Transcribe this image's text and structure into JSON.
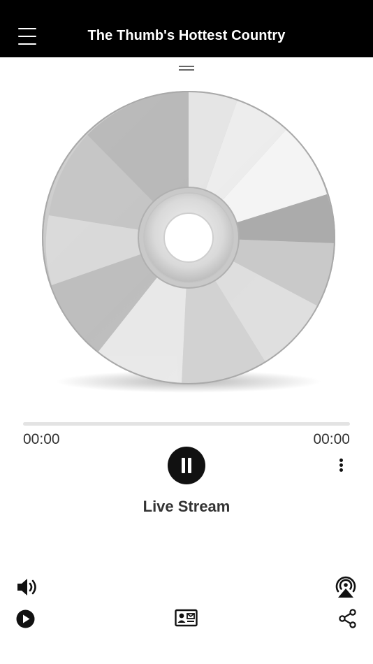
{
  "header": {
    "title": "The Thumb's Hottest Country"
  },
  "player": {
    "elapsed": "00:00",
    "duration": "00:00",
    "progress": 0,
    "track_title": "Live Stream",
    "state": "playing"
  },
  "icons": {
    "menu": "hamburger-menu-icon",
    "drag": "drag-handle-icon",
    "pause": "pause-icon",
    "more": "more-vertical-icon",
    "volume": "volume-icon",
    "airplay": "airplay-icon",
    "play": "play-icon",
    "contact": "contact-card-icon",
    "share": "share-icon"
  },
  "colors": {
    "header_bg": "#000000",
    "accent": "#111111",
    "track": "#e3e3e3"
  }
}
